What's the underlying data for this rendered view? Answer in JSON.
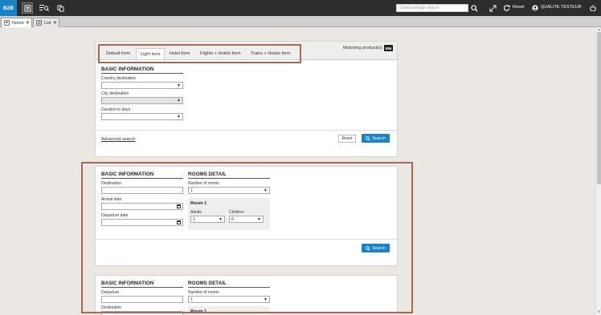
{
  "topbar": {
    "logo": "B2B",
    "search_placeholder": "Quick package search",
    "reset_label": "Reset",
    "user_name": "QUALITE TESTEUR"
  },
  "window_tabs": [
    {
      "label": "Home",
      "close": "×"
    },
    {
      "label": "List",
      "close": "×"
    }
  ],
  "search_panel": {
    "tabs": [
      "Default form",
      "Light form",
      "Hotel form",
      "Flights + Hotels form",
      "Trains + Hotels form"
    ],
    "active_tab": "Light form",
    "matching_label": "Matching product(s)",
    "matching_count": "696",
    "section_title": "BASIC INFORMATION",
    "fields": {
      "country_label": "Country destination",
      "city_label": "City destination",
      "duration_label": "Duration in days"
    },
    "advanced_link": "Advanced search",
    "reset_button": "Reset",
    "search_button": "Search"
  },
  "hotel_panel": {
    "basic_title": "BASIC INFORMATION",
    "rooms_title": "ROOMS DETAIL",
    "destination_label": "Destination",
    "arrival_label": "Arrival date",
    "departure_label": "Departure date",
    "rooms_label": "Number of rooms",
    "rooms_value": "1",
    "room_title": "Room 1",
    "adults_label": "Adults",
    "adults_value": "1",
    "children_label": "Children",
    "children_value": "0",
    "search_button": "Search"
  },
  "flight_panel": {
    "basic_title": "BASIC INFORMATION",
    "rooms_title": "ROOMS DETAIL",
    "departure_label": "Departure",
    "destination_label": "Destination",
    "rooms_label": "Number of rooms",
    "rooms_value": "1",
    "room_title": "Room 1"
  },
  "colors": {
    "accent": "#1b82c5",
    "topbar": "#2d2d2d",
    "highlight": "#a66b4f"
  }
}
